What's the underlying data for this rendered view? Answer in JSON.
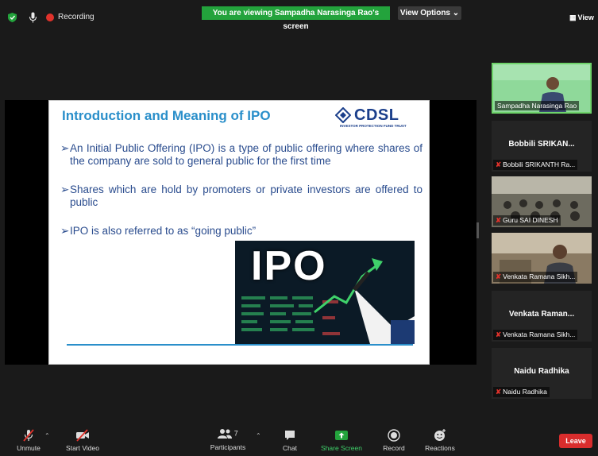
{
  "topbar": {
    "recording_label": "Recording",
    "viewing_banner": "You are viewing Sampadha Narasinga Rao's screen",
    "view_options": "View Options ⌄"
  },
  "slide": {
    "title": "Introduction and Meaning of IPO",
    "logo_text": "CDSL",
    "logo_subtext": "INVESTOR PROTECTION FUND TRUST",
    "bullets": [
      "An Initial Public Offering (IPO) is a type of public offering where shares of the company are sold to general public for the first time",
      "Shares which are hold by promoters or private investors are offered to public",
      "IPO is also referred to as “going public”"
    ],
    "bullet_mark": "➢",
    "image_text": "IPO"
  },
  "panel": {
    "view_label": "View",
    "participants": [
      {
        "center_name": "",
        "tag": "Sampadha Narasinga Rao",
        "muted": false,
        "video": true
      },
      {
        "center_name": "Bobbili  SRIKAN...",
        "tag": "Bobbili SRIKANTH Ra...",
        "muted": true,
        "video": false
      },
      {
        "center_name": "",
        "tag": "Guru SAI DINESH",
        "muted": true,
        "video": true
      },
      {
        "center_name": "",
        "tag": "Venkata Ramana Sikh...",
        "muted": true,
        "video": true
      },
      {
        "center_name": "Venkata  Raman...",
        "tag": "Venkata Ramana Sikh...",
        "muted": true,
        "video": false
      },
      {
        "center_name": "Naidu Radhika",
        "tag": "Naidu Radhika",
        "muted": true,
        "video": false
      }
    ]
  },
  "toolbar": {
    "unmute": "Unmute",
    "start_video": "Start Video",
    "participants": "Participants",
    "participants_count": "7",
    "chat": "Chat",
    "share_screen": "Share Screen",
    "record": "Record",
    "reactions": "Reactions",
    "leave": "Leave"
  },
  "colors": {
    "banner_green": "#23a33c",
    "leave_red": "#d92d2d",
    "slide_title_blue": "#2a8fca",
    "slide_text_blue": "#2a4c8e",
    "active_speaker_border": "#6ed36a"
  }
}
